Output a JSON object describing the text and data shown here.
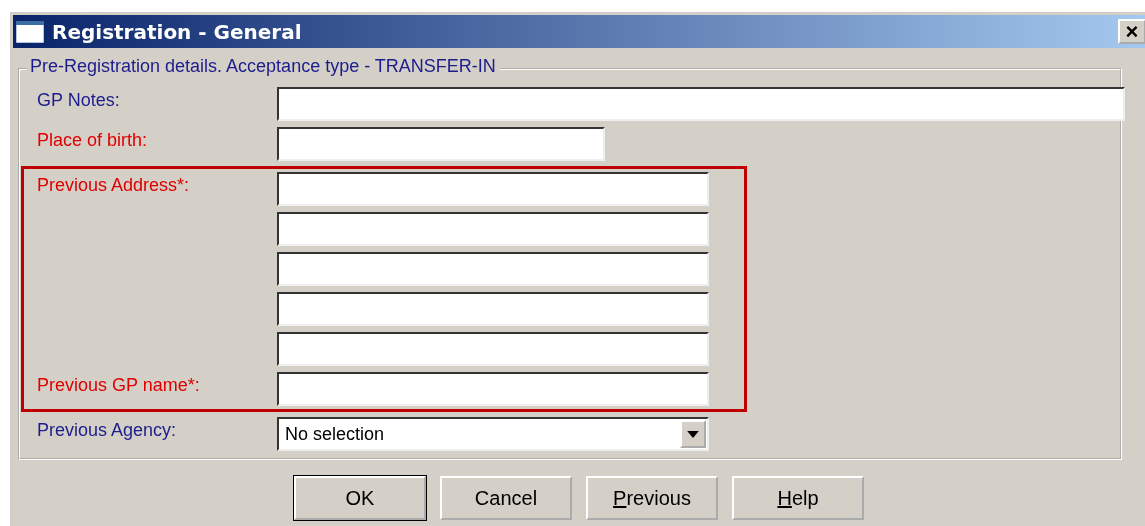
{
  "window": {
    "title": "Registration - General",
    "close": "×"
  },
  "group": {
    "title": "Pre-Registration details. Acceptance type - TRANSFER-IN"
  },
  "sections": [
    {
      "highlighted": false,
      "rows": [
        {
          "label": "GP Notes:",
          "required": false,
          "kind": "wide"
        },
        {
          "label": "Place of birth:",
          "required": true,
          "kind": "short"
        }
      ]
    },
    {
      "highlighted": true,
      "rows": [
        {
          "label": "Previous Address*:",
          "required": true,
          "kind": "medium"
        },
        {
          "kind": "medium"
        },
        {
          "kind": "medium"
        },
        {
          "kind": "medium"
        },
        {
          "kind": "medium"
        },
        {
          "label": "Previous GP name*:",
          "required": true,
          "kind": "medium"
        }
      ]
    },
    {
      "highlighted": false,
      "rows": [
        {
          "label": "Previous Agency:",
          "required": false,
          "kind": "dropdown",
          "value": "No selection"
        }
      ]
    }
  ],
  "buttons": [
    {
      "label": "OK",
      "default": true
    },
    {
      "label": "Cancel",
      "default": false
    },
    {
      "mnemonic": "P",
      "label": "revious",
      "default": false
    },
    {
      "mnemonic": "H",
      "label": "elp",
      "default": false
    }
  ]
}
